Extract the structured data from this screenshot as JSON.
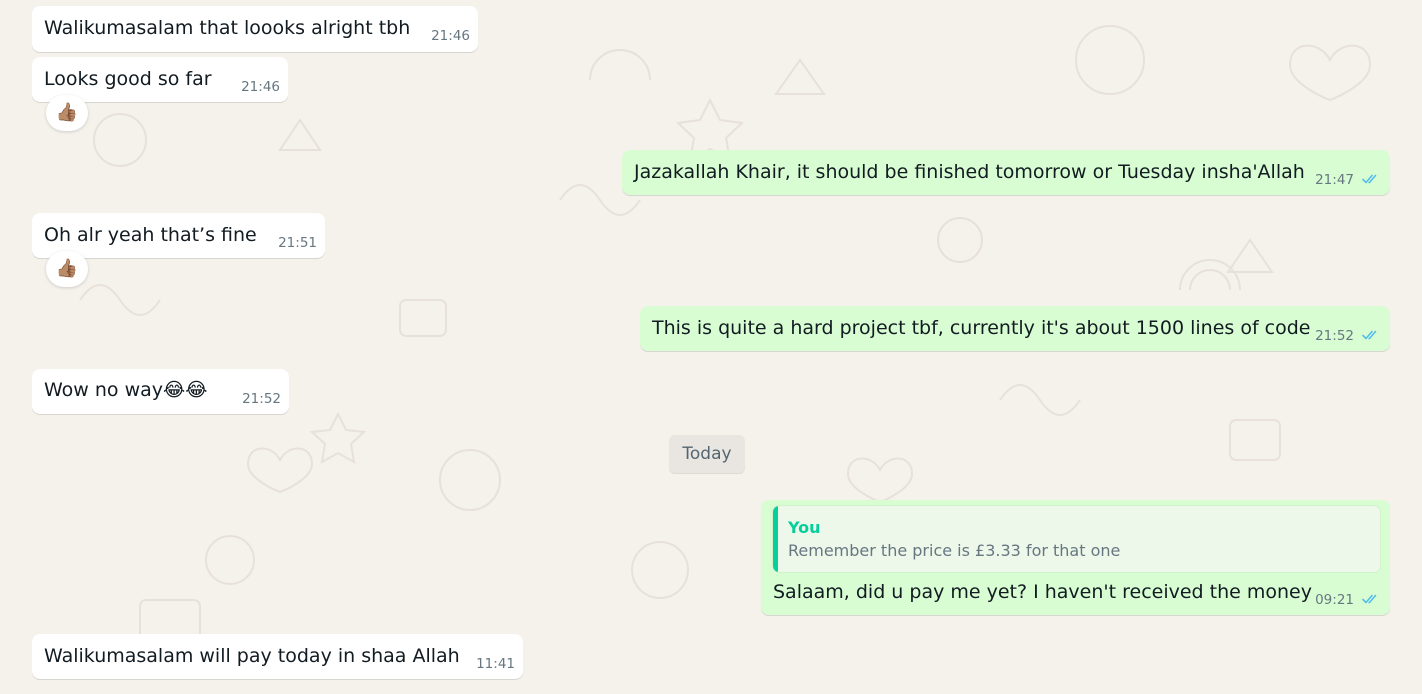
{
  "messages": [
    {
      "text": "Walikumasalam that loooks alright tbh",
      "time": "21:46"
    },
    {
      "text": "Looks good so far",
      "time": "21:46",
      "reaction": "👍🏽"
    },
    {
      "text": "Jazakallah Khair, it should be finished tomorrow or Tuesday insha'Allah",
      "time": "21:47"
    },
    {
      "text": "Oh alr yeah that’s fine",
      "time": "21:51",
      "reaction": "👍🏽"
    },
    {
      "text": "This is quite a hard project tbf, currently it's about 1500 lines of code",
      "time": "21:52"
    },
    {
      "text": "Wow no way😂😂",
      "time": "21:52"
    },
    {
      "text": "Salaam, did u pay me yet? I haven't received the money",
      "time": "09:21",
      "quote": {
        "author": "You",
        "text": "Remember the price is £3.33 for that one"
      }
    },
    {
      "text": "Walikumasalam will pay today in shaa Allah",
      "time": "11:41"
    }
  ],
  "date_separator": "Today",
  "colors": {
    "background": "#f5f1eb",
    "incoming": "#ffffff",
    "outgoing": "#d9fdd3",
    "read_ticks": "#53bdeb",
    "quote_accent": "#06cf9c"
  },
  "icons": {
    "read_receipt": "double-check-icon"
  }
}
